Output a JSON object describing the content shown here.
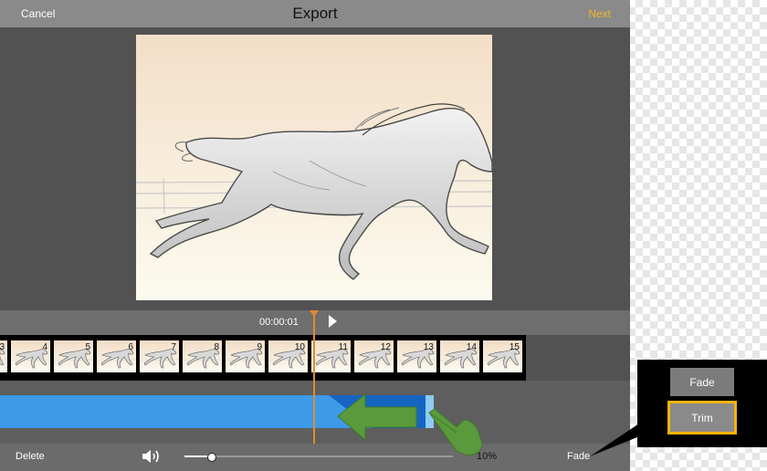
{
  "header": {
    "cancel_label": "Cancel",
    "title": "Export",
    "next_label": "Next"
  },
  "preview": {
    "alt": "horse sketch frame"
  },
  "timeline": {
    "timecode": "00:00:01",
    "frames": [
      "3",
      "4",
      "5",
      "6",
      "7",
      "8",
      "9",
      "10",
      "11",
      "12",
      "13",
      "14",
      "15"
    ]
  },
  "bottom": {
    "delete_label": "Delete",
    "volume_percent": "10%",
    "volume_fraction": 0.1,
    "fade_label": "Fade"
  },
  "popup": {
    "fade_label": "Fade",
    "trim_label": "Trim"
  },
  "colors": {
    "accent": "#f1b62a",
    "clip": "#3d9ae8",
    "playhead": "#e58a2c",
    "highlight": "#f4b400",
    "annotation_arrow": "#5a9a3c"
  },
  "icons": {
    "play": "play-icon",
    "speaker": "speaker-icon",
    "left_arrow": "left-arrow-icon",
    "hand": "hand-pointer-icon"
  }
}
